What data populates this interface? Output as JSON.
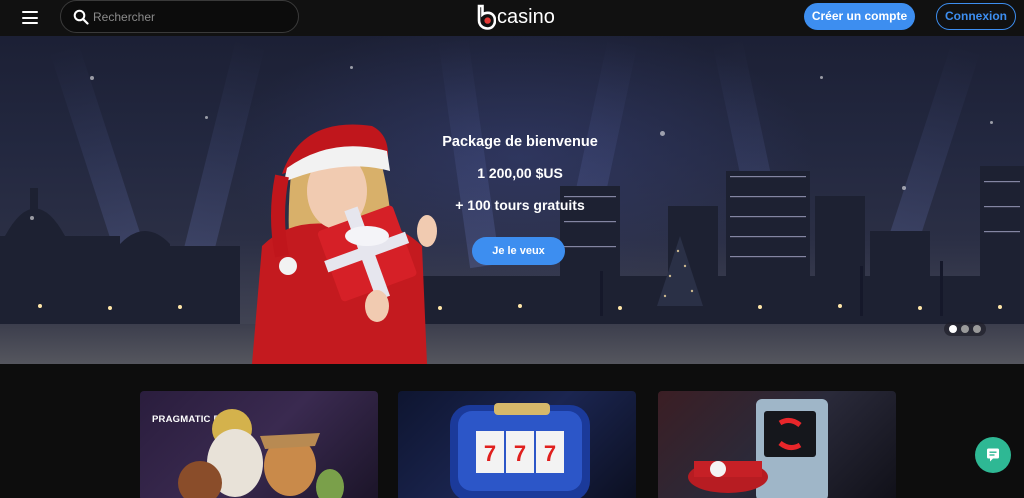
{
  "header": {
    "menu_icon": "hamburger-icon",
    "search": {
      "placeholder": "Rechercher",
      "icon": "search-icon"
    },
    "logo_text": "casino",
    "signup_label": "Créer un compte",
    "login_label": "Connexion"
  },
  "hero": {
    "title": "Package de bienvenue",
    "amount": "1 200,00 $US",
    "spins": "+ 100 tours gratuits",
    "cta_label": "Je le veux",
    "slides": 3,
    "active_slide": 1
  },
  "games": {
    "tiles": [
      {
        "brand": "PRAGMATIC PLAY"
      },
      {
        "brand": ""
      },
      {
        "brand": ""
      }
    ]
  },
  "chat": {
    "icon": "chat-icon"
  },
  "colors": {
    "accent": "#3d8ef0",
    "chat": "#2eb894",
    "header_bg": "#111111"
  }
}
